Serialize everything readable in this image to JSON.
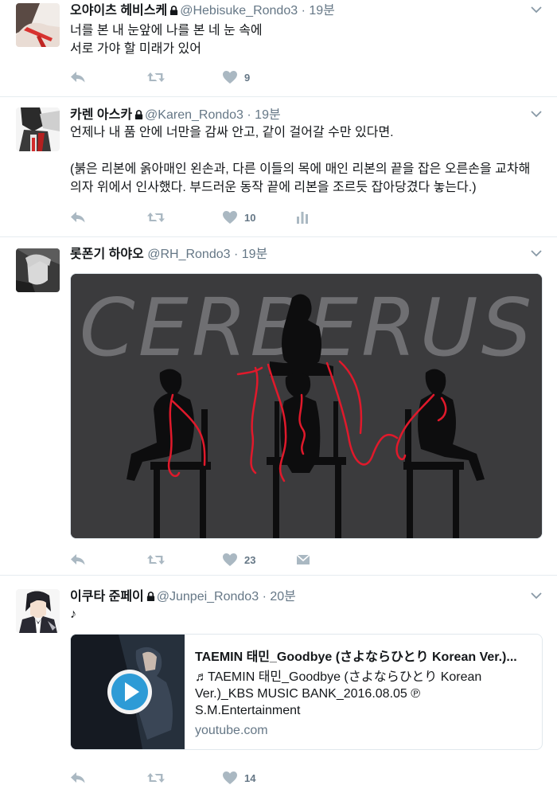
{
  "tweets": [
    {
      "name": "오야이츠 헤비스케",
      "handle": "@Hebisuke_Rondo3",
      "time": "· 19분",
      "lines": [
        "너를 본 내 눈앞에 나를 본 네 눈 속에",
        "서로 가야 할 미래가 있어"
      ],
      "likes": "9"
    },
    {
      "name": "카렌 아스카",
      "handle": "@Karen_Rondo3",
      "time": "· 19분",
      "lines": [
        "언제나 내 품 안에 너만을 감싸 안고, 같이 걸어갈 수만 있다면.",
        "",
        "(붉은 리본에 옭아매인 왼손과, 다른 이들의 목에 매인 리본의 끝을 잡은 오른손을 교차해",
        "의자 위에서 인사했다. 부드러운 동작 끝에 리본을 조르듯 잡아당겼다 놓는다.)"
      ],
      "likes": "10"
    },
    {
      "name": "롯폰기 하야오",
      "handle": "@RH_Rondo3",
      "time": "· 19분",
      "image_text": "CERBERUS",
      "likes": "23"
    },
    {
      "name": "이쿠타 준페이",
      "handle": "@Junpei_Rondo3",
      "time": "· 20분",
      "lines": [
        "♪"
      ],
      "card": {
        "title": "TAEMIN 태민_Goodbye (さよならひとり Korean Ver.)...",
        "description": "♬TAEMIN 태민_Goodbye (さよならひとり Korean Ver.)_KBS MUSIC BANK_2016.08.05 ℗ S.M.Entertainment",
        "domain": "youtube.com"
      },
      "likes": "14"
    }
  ],
  "colors": {
    "text": "#14171a",
    "secondary": "#657786",
    "icon": "#aab8c2",
    "border": "#e6ecf0",
    "ribbon": "#e0192b"
  },
  "icons": [
    "lock-icon",
    "caret-down-icon",
    "reply-icon",
    "retweet-icon",
    "heart-icon",
    "analytics-icon",
    "direct-message-icon",
    "play-icon"
  ]
}
